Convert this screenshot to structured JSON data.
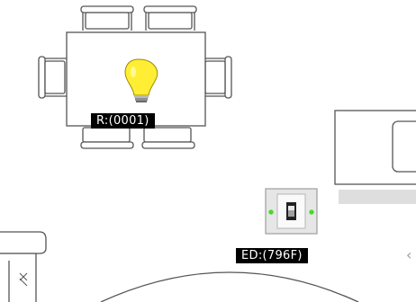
{
  "floorplan": {
    "labels": {
      "room_light": "R:(0001)",
      "door_switch": "ED:(796F)"
    },
    "icons": {
      "light_bulb": "light-bulb-icon",
      "wall_switch": "wall-switch-icon",
      "chevron": "chevron-left-icon"
    },
    "chevron_glyph": "‹",
    "colors": {
      "bulb_on": "#ffee33",
      "status_led": "#44dd22",
      "furniture_stroke": "#555555",
      "label_bg": "#000000",
      "label_text": "#ffffff"
    }
  }
}
